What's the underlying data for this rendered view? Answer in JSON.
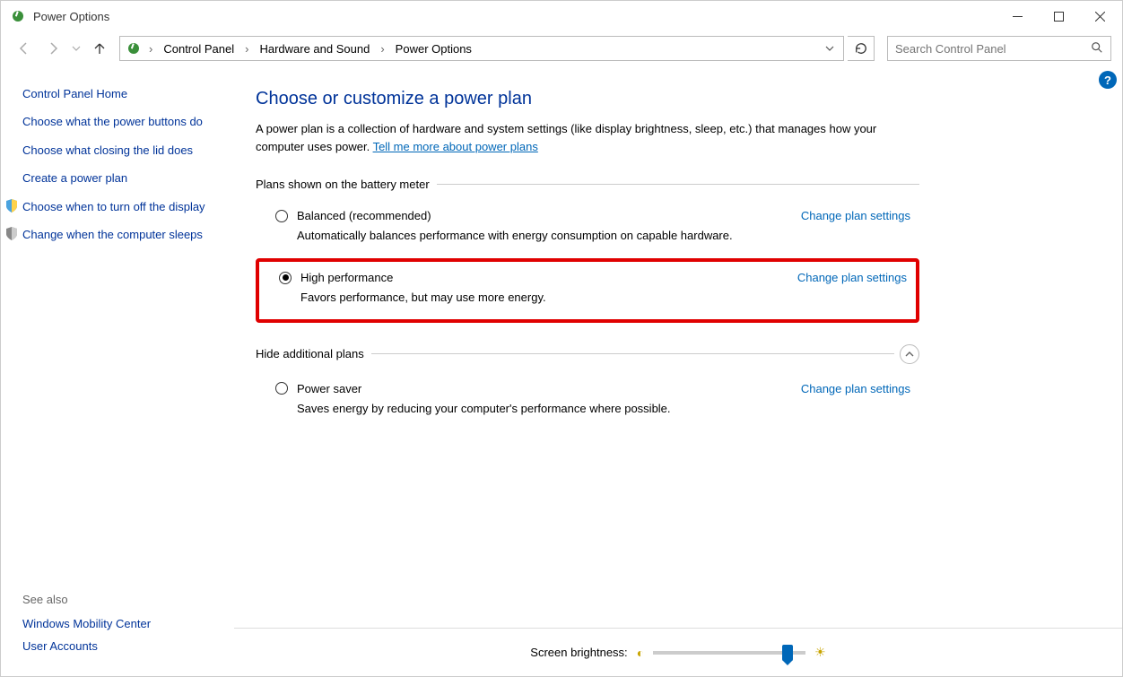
{
  "window": {
    "title": "Power Options"
  },
  "breadcrumb": {
    "items": [
      "Control Panel",
      "Hardware and Sound",
      "Power Options"
    ]
  },
  "search": {
    "placeholder": "Search Control Panel"
  },
  "sidebar": {
    "home": "Control Panel Home",
    "links": [
      {
        "label": "Choose what the power buttons do",
        "icon": false
      },
      {
        "label": "Choose what closing the lid does",
        "icon": false
      },
      {
        "label": "Create a power plan",
        "icon": false
      },
      {
        "label": "Choose when to turn off the display",
        "icon": true
      },
      {
        "label": "Change when the computer sleeps",
        "icon": true
      }
    ]
  },
  "seeAlso": {
    "heading": "See also",
    "links": [
      "Windows Mobility Center",
      "User Accounts"
    ]
  },
  "main": {
    "heading": "Choose or customize a power plan",
    "descPrefix": "A power plan is a collection of hardware and system settings (like display brightness, sleep, etc.) that manages how your computer uses power. ",
    "descLink": "Tell me more about power plans",
    "group1Label": "Plans shown on the battery meter",
    "group2Label": "Hide additional plans",
    "changeLink": "Change plan settings",
    "plans": [
      {
        "name": "Balanced (recommended)",
        "desc": "Automatically balances performance with energy consumption on capable hardware.",
        "selected": false
      },
      {
        "name": "High performance",
        "desc": "Favors performance, but may use more energy.",
        "selected": true
      }
    ],
    "extraPlans": [
      {
        "name": "Power saver",
        "desc": "Saves energy by reducing your computer's performance where possible.",
        "selected": false
      }
    ]
  },
  "brightness": {
    "label": "Screen brightness:",
    "percent": 88
  }
}
